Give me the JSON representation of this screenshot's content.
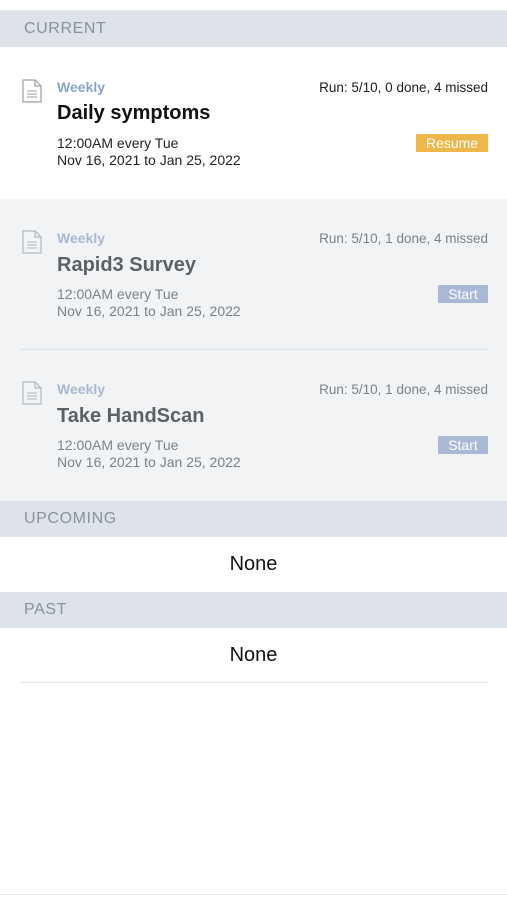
{
  "sections": {
    "current": "CURRENT",
    "upcoming": "UPCOMING",
    "past": "PAST"
  },
  "current_items": [
    {
      "frequency": "Weekly",
      "run_info": "Run: 5/10, 0 done, 4 missed",
      "title": "Daily symptoms",
      "schedule": "12:00AM every Tue",
      "date_range": "Nov 16, 2021 to Jan 25, 2022",
      "action": "Resume"
    },
    {
      "frequency": "Weekly",
      "run_info": "Run: 5/10, 1 done, 4 missed",
      "title": "Rapid3 Survey",
      "schedule": "12:00AM every Tue",
      "date_range": "Nov 16, 2021 to Jan 25, 2022",
      "action": "Start"
    },
    {
      "frequency": "Weekly",
      "run_info": "Run: 5/10, 1 done, 4 missed",
      "title": "Take HandScan",
      "schedule": "12:00AM every Tue",
      "date_range": "Nov 16, 2021 to Jan 25, 2022",
      "action": "Start"
    }
  ],
  "upcoming_empty": "None",
  "past_empty": "None",
  "colors": {
    "resume_button": "#efb64a",
    "start_button": "#a9b8d6",
    "frequency_text": "#8aa3c7",
    "section_header_bg": "#dde3e8"
  }
}
